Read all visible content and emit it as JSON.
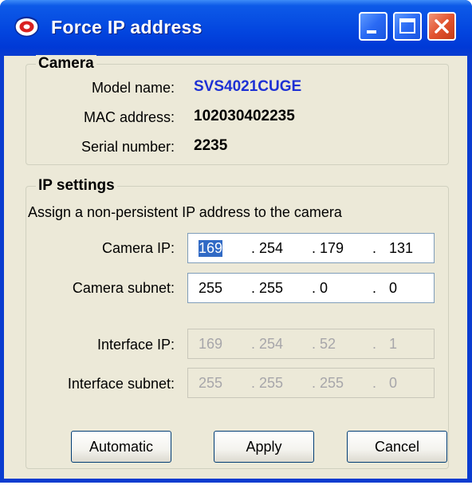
{
  "window": {
    "title": "Force IP address"
  },
  "camera_group": {
    "title": "Camera",
    "model_label": "Model name:",
    "model_value": "SVS4021CUGE",
    "mac_label": "MAC address:",
    "mac_value": "102030402235",
    "serial_label": "Serial number:",
    "serial_value": "2235"
  },
  "ip_group": {
    "title": "IP settings",
    "description": "Assign a non-persistent IP address to the camera",
    "camera_ip": {
      "label": "Camera IP:",
      "octets": [
        "169",
        "254",
        "179",
        "131"
      ],
      "dots": [
        ".",
        ".",
        "."
      ]
    },
    "camera_subnet": {
      "label": "Camera subnet:",
      "octets": [
        "255",
        "255",
        "0",
        "0"
      ],
      "dots": [
        ".",
        ".",
        "."
      ]
    },
    "interface_ip": {
      "label": "Interface IP:",
      "octets": [
        "169",
        "254",
        "52",
        "1"
      ],
      "dots": [
        ".",
        ".",
        "."
      ]
    },
    "interface_subnet": {
      "label": "Interface subnet:",
      "octets": [
        "255",
        "255",
        "255",
        "0"
      ],
      "dots": [
        ".",
        ".",
        "."
      ]
    }
  },
  "buttons": {
    "automatic": "Automatic",
    "apply": "Apply",
    "cancel": "Cancel"
  },
  "colors": {
    "title_bar": "#0346df",
    "dialog_bg": "#ece9d8",
    "model_value": "#1d30d4",
    "selection": "#316ac5"
  },
  "icons": [
    "network-camera-icon",
    "minimize-icon",
    "maximize-icon",
    "close-icon"
  ]
}
